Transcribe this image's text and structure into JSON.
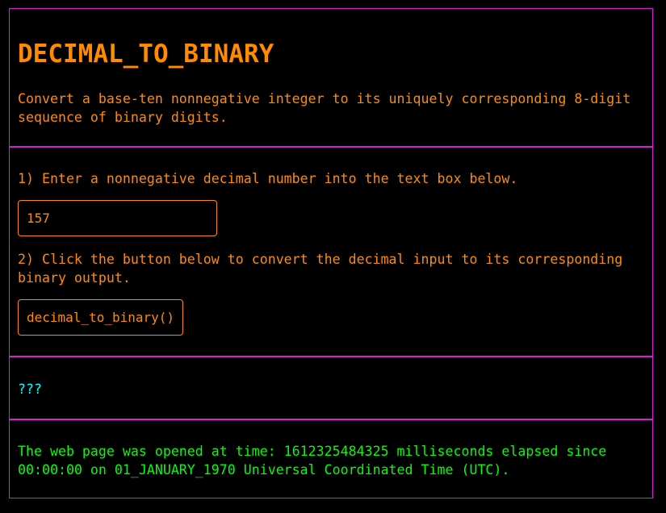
{
  "header": {
    "title": "DECIMAL_TO_BINARY",
    "description": "Convert a base-ten nonnegative integer to its uniquely corresponding 8-digit sequence of binary digits."
  },
  "form": {
    "step1_label": "1) Enter a nonnegative decimal number into the text box below.",
    "input_value": "157",
    "step2_label": "2) Click the button below to convert the decimal input to its corresponding binary output.",
    "button_label": "decimal_to_binary()"
  },
  "output": {
    "result": "???"
  },
  "footer": {
    "timestamp_text": "The web page was opened at time: 1612325484325 milliseconds elapsed since 00:00:00 on 01_JANUARY_1970 Universal Coordinated Time (UTC)."
  },
  "colors": {
    "border": "#d81ed8",
    "primary_text": "#ff8c00",
    "output_text": "#00ffff",
    "footer_text": "#00ff00",
    "background": "#000000"
  }
}
